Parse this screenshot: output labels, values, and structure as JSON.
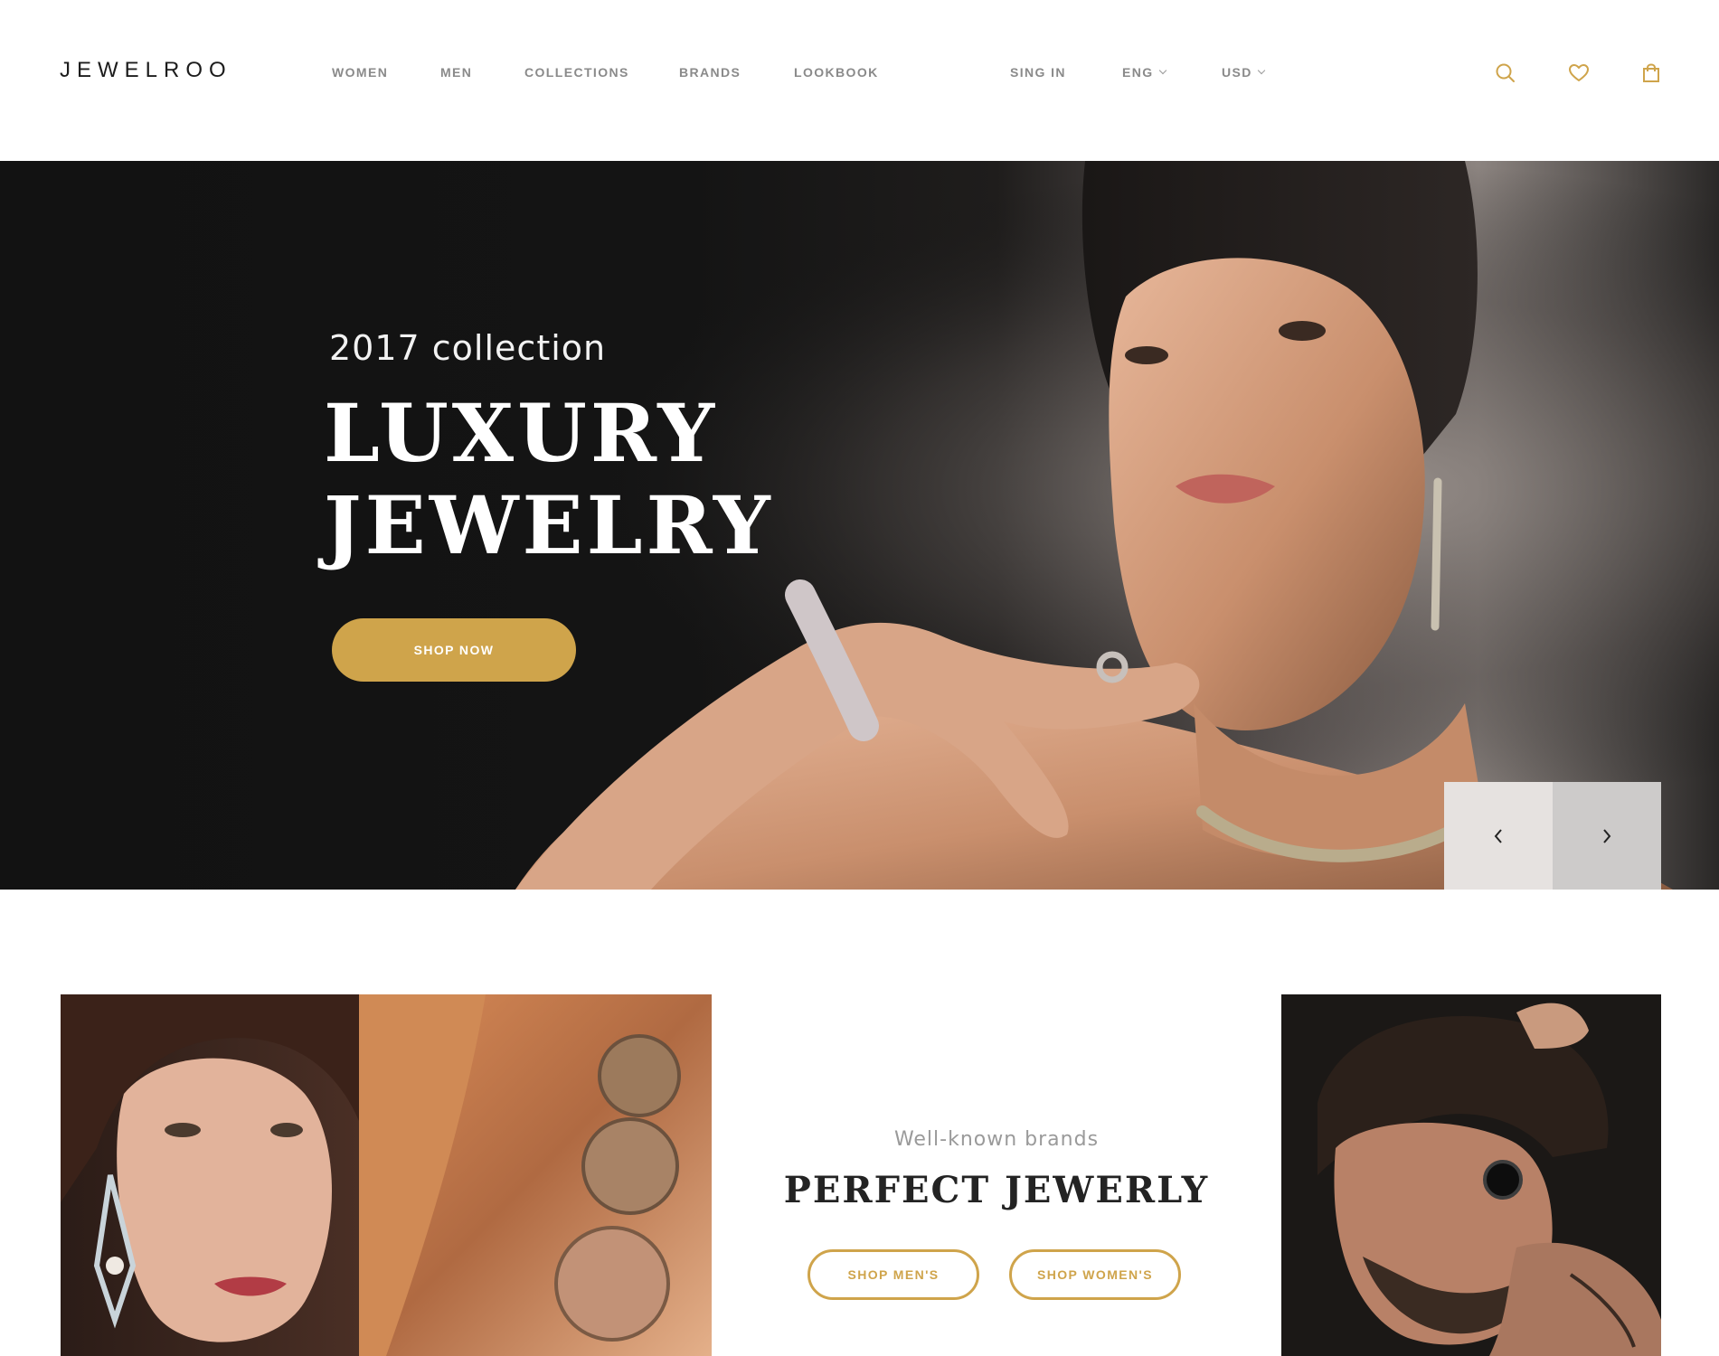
{
  "header": {
    "logo": "JEWELROO",
    "nav": [
      {
        "label": "WOMEN"
      },
      {
        "label": "MEN"
      },
      {
        "label": "COLLECTIONS"
      },
      {
        "label": "BRANDS"
      },
      {
        "label": "LOOKBOOK"
      }
    ],
    "sign_in": "SING IN",
    "language": "ENG",
    "currency": "USD",
    "icons": [
      "search-icon",
      "heart-icon",
      "shopping-bag-icon"
    ],
    "accent_color": "#cfa44b"
  },
  "hero": {
    "subtitle": "2017 collection",
    "title_line1": "LUXURY",
    "title_line2": "JEWELRY",
    "cta": "SHOP NOW",
    "prev_icon": "chevron-left-icon",
    "next_icon": "chevron-right-icon"
  },
  "promo": {
    "subtitle": "Well-known brands",
    "title": "PERFECT JEWERLY",
    "btn_men": "SHOP MEN'S",
    "btn_women": "SHOP WOMEN'S"
  }
}
